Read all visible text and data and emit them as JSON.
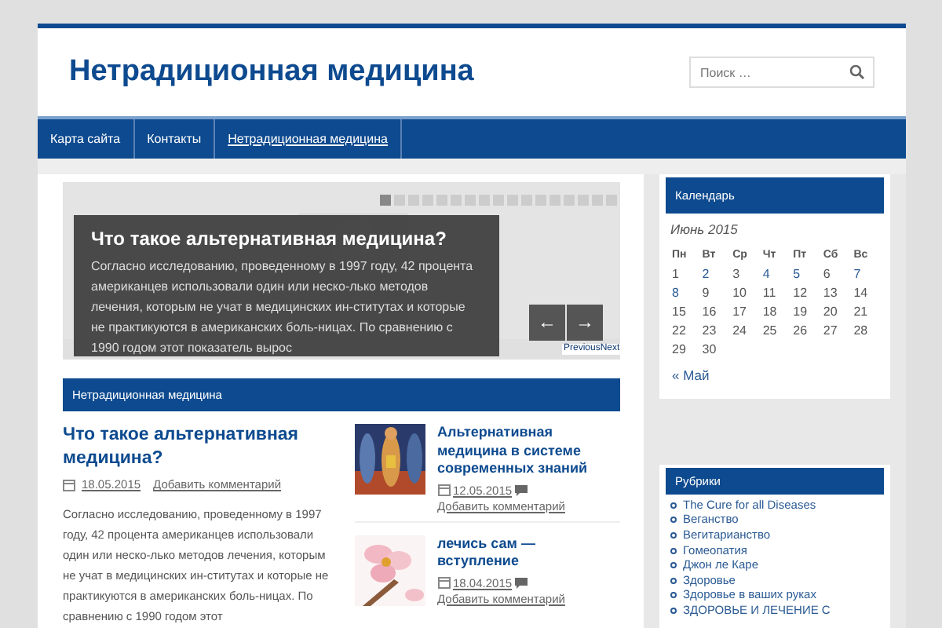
{
  "site_title": "Нетрадиционная медицина",
  "search": {
    "placeholder": "Поиск …"
  },
  "nav": [
    {
      "label": "Карта сайта",
      "selected": false
    },
    {
      "label": "Контакты",
      "selected": false
    },
    {
      "label": "Нетрадиционная медицина",
      "selected": true
    }
  ],
  "slider": {
    "dots": [
      {
        "selected": true
      },
      {
        "selected": false
      },
      {
        "selected": false
      },
      {
        "selected": false
      },
      {
        "selected": false
      },
      {
        "selected": false
      },
      {
        "selected": false
      },
      {
        "selected": false
      },
      {
        "selected": false
      },
      {
        "selected": false
      },
      {
        "selected": false
      },
      {
        "selected": false
      },
      {
        "selected": false
      },
      {
        "selected": false
      },
      {
        "selected": false
      },
      {
        "selected": false
      },
      {
        "selected": false
      }
    ],
    "title": "Что такое альтернативная медицина?",
    "text": "Согласно исследованию, проведенному в 1997 году, 42 процента американцев использовали один или неско-лько методов лечения, которым не учат в медицинских ин-ститутах и которые не практикуются в американских боль-ницах. По сравнению с 1990 годом этот показатель вырос",
    "prev": "←",
    "next": "→",
    "nav_text": "PreviousNext"
  },
  "category_heading": "Нетрадиционная медицина",
  "main_post": {
    "title": "Что такое альтернативная медицина?",
    "date": "18.05.2015",
    "comments": "Добавить комментарий",
    "text": "Согласно исследованию, проведенному в 1997 году, 42 процента американцев использовали один или неско-лько методов лечения, которым не учат в медицинских ин-ститутах и которые не практикуются в американских боль-ницах. По сравнению с 1990 годом этот"
  },
  "side_posts": [
    {
      "kind": "body",
      "title": "Альтернативная медицина в системе современных знаний",
      "date": "12.05.2015",
      "comments": "Добавить комментарий"
    },
    {
      "kind": "flower",
      "title": "лечись сам — вступление",
      "date": "18.04.2015",
      "comments": "Добавить комментарий"
    }
  ],
  "calendar": {
    "heading": "Календарь",
    "caption": "Июнь 2015",
    "weekdays": [
      "Пн",
      "Вт",
      "Ср",
      "Чт",
      "Пт",
      "Сб",
      "Вс"
    ],
    "weeks": [
      [
        {
          "day": "1",
          "linked": false
        },
        {
          "day": "2",
          "linked": true
        },
        {
          "day": "3",
          "linked": false
        },
        {
          "day": "4",
          "linked": true
        },
        {
          "day": "5",
          "linked": true
        },
        {
          "day": "6",
          "linked": false
        },
        {
          "day": "7",
          "linked": true
        }
      ],
      [
        {
          "day": "8",
          "linked": true
        },
        {
          "day": "9",
          "linked": false
        },
        {
          "day": "10",
          "linked": false
        },
        {
          "day": "11",
          "linked": false
        },
        {
          "day": "12",
          "linked": false
        },
        {
          "day": "13",
          "linked": false
        },
        {
          "day": "14",
          "linked": false
        }
      ],
      [
        {
          "day": "15",
          "linked": false
        },
        {
          "day": "16",
          "linked": false
        },
        {
          "day": "17",
          "linked": false
        },
        {
          "day": "18",
          "linked": false
        },
        {
          "day": "19",
          "linked": false
        },
        {
          "day": "20",
          "linked": false
        },
        {
          "day": "21",
          "linked": false
        }
      ],
      [
        {
          "day": "22",
          "linked": false
        },
        {
          "day": "23",
          "linked": false
        },
        {
          "day": "24",
          "linked": false
        },
        {
          "day": "25",
          "linked": false
        },
        {
          "day": "26",
          "linked": false
        },
        {
          "day": "27",
          "linked": false
        },
        {
          "day": "28",
          "linked": false
        }
      ],
      [
        {
          "day": "29",
          "linked": false
        },
        {
          "day": "30",
          "linked": false
        }
      ]
    ],
    "prev_link": "« Май"
  },
  "categories": {
    "heading": "Рубрики",
    "items": [
      "The Cure for all Diseases",
      "Веганство",
      "Вегитарианство",
      "Гомеопатия",
      "Джон ле Каре",
      "Здоровье",
      "Здоровье в ваших руках",
      "ЗДОРОВЬЕ И ЛЕЧЕНИЕ С"
    ]
  }
}
